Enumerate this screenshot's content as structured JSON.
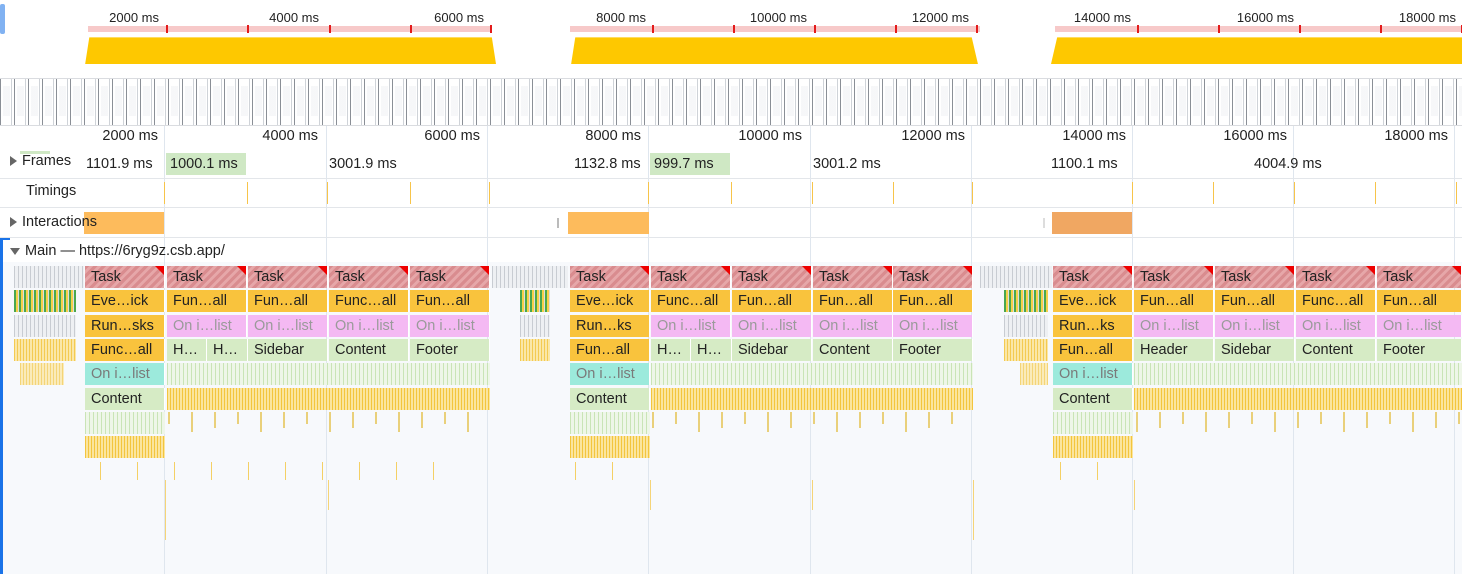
{
  "overview": {
    "ticks": [
      "2000 ms",
      "4000 ms",
      "6000 ms",
      "8000 ms",
      "10000 ms",
      "12000 ms",
      "14000 ms",
      "16000 ms",
      "18000 ms"
    ]
  },
  "timeline": {
    "ticks": [
      "2000 ms",
      "4000 ms",
      "6000 ms",
      "8000 ms",
      "10000 ms",
      "12000 ms",
      "14000 ms",
      "16000 ms",
      "18000 ms"
    ]
  },
  "tracks": {
    "frames_label": "Frames",
    "timings_label": "Timings",
    "interactions_label": "Interactions",
    "main_label": "Main — https://6ryg9z.csb.app/"
  },
  "frames": [
    "1101.9 ms",
    "1000.1 ms",
    "3001.9 ms",
    "1132.8 ms",
    "999.7 ms",
    "3001.2 ms",
    "1100.1 ms",
    "4004.9 ms"
  ],
  "flame": {
    "task": "Task",
    "row2": [
      "Eve…ick",
      "Fun…all",
      "Fun…all",
      "Func…all",
      "Fun…all",
      "Eve…ick",
      "Func…all",
      "Fun…all",
      "Fun…all",
      "Fun…all",
      "Eve…ick",
      "Fun…all",
      "Fun…all",
      "Func…all",
      "Fun…all"
    ],
    "row3": [
      "Run…sks",
      "On i…list",
      "On i…list",
      "On i…list",
      "On i…list",
      "Run…ks",
      "On i…list",
      "On i…list",
      "On i…list",
      "On i…list",
      "Run…ks",
      "On i…list",
      "On i…list",
      "On i…list",
      "On i…list"
    ],
    "row4": [
      "Func…all",
      "H…",
      "H…",
      "Sidebar",
      "Content",
      "Footer",
      "Fun…all",
      "H…",
      "H…",
      "Sidebar",
      "Content",
      "Footer",
      "Fun…all",
      "Header",
      "Sidebar",
      "Content",
      "Footer"
    ],
    "row5": [
      "On i…list",
      "On i…list",
      "On i…list"
    ],
    "row6": [
      "Content",
      "Content",
      "Content"
    ]
  },
  "colors": {
    "task": "#d98c8f",
    "scripting": "#f9c33d",
    "render": "#f4b9f3",
    "component": "#d6ebc5",
    "accent": "#1a73e8"
  }
}
